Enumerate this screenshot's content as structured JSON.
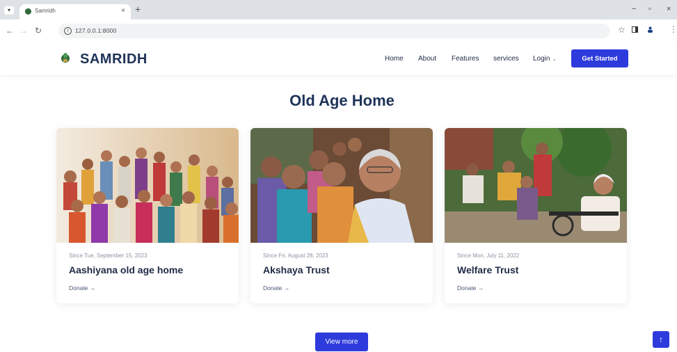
{
  "browser": {
    "tab_title": "Samridh",
    "tab_close": "×",
    "new_tab": "+",
    "url": "127.0.0.1:8000",
    "window_controls": [
      "−",
      "▫",
      "×"
    ]
  },
  "header": {
    "brand": "SAMRIDH",
    "nav": [
      "Home",
      "About",
      "Features",
      "services",
      "Login"
    ],
    "cta": "Get Started"
  },
  "main": {
    "title": "Old Age Home",
    "cards": [
      {
        "since": "Since Tue, September 15, 2023",
        "name": "Aashiyana old age home",
        "donate": "Donate →"
      },
      {
        "since": "Since Fri, August 28, 2023",
        "name": "Akshaya Trust",
        "donate": "Donate →"
      },
      {
        "since": "Since Mon, July 11, 2022",
        "name": "Welfare Trust",
        "donate": "Donate →"
      }
    ],
    "view_more": "View more",
    "scroll_top": "↑"
  },
  "colors": {
    "accent": "#2d3bdc",
    "brand_text": "#1e3358"
  }
}
